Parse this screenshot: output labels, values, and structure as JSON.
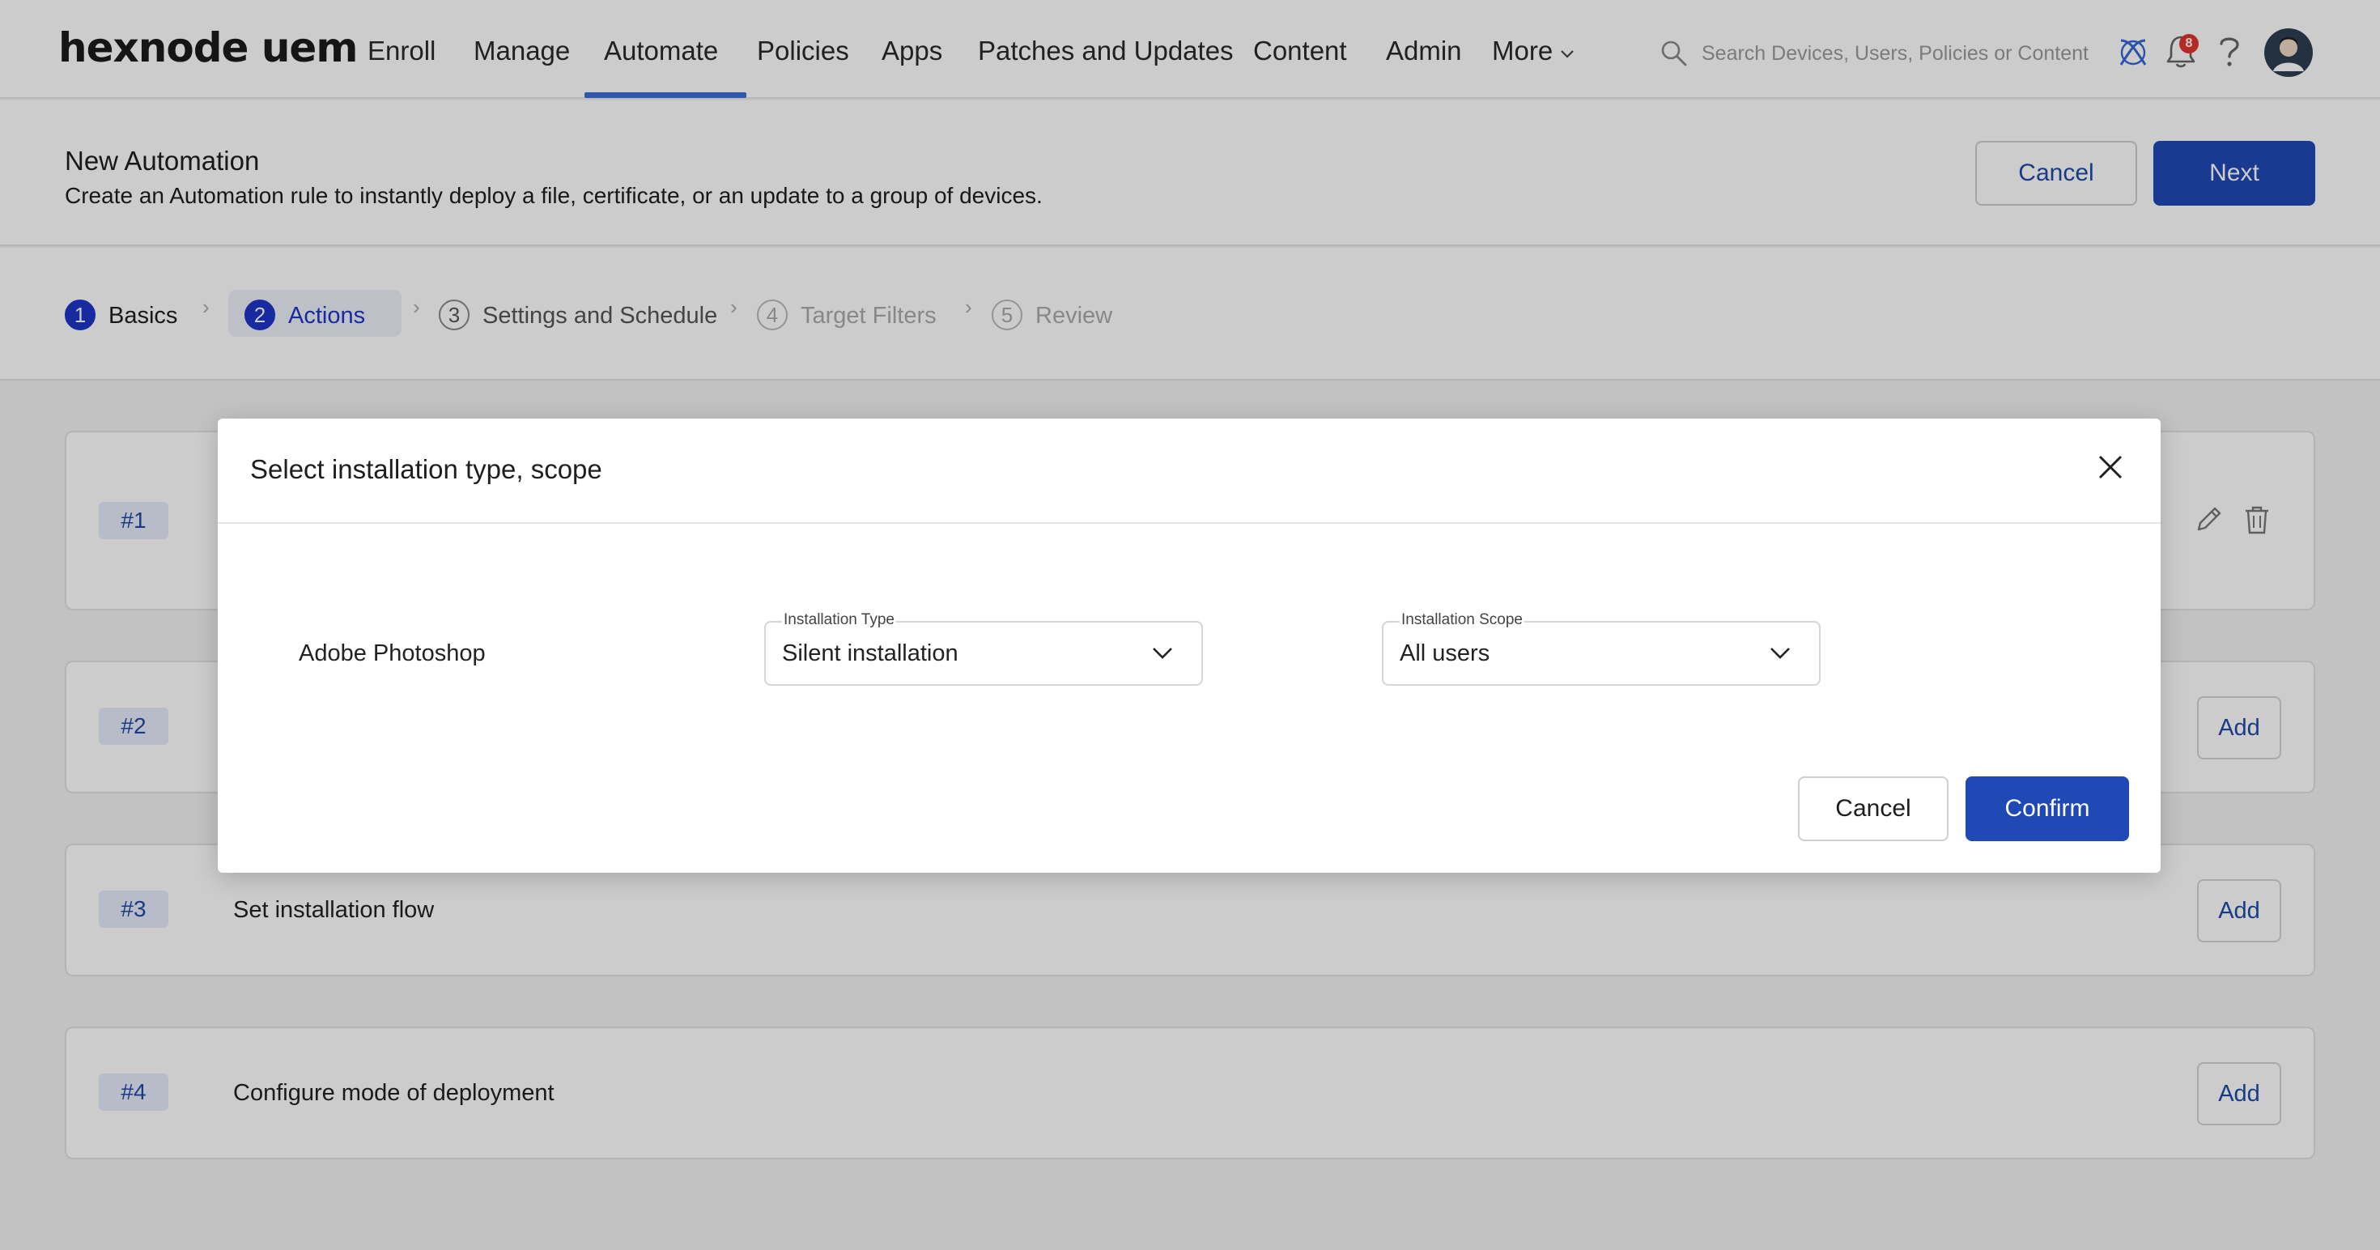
{
  "app": {
    "logo_text": "hexnode uem"
  },
  "nav": {
    "items": [
      {
        "label": "Enroll"
      },
      {
        "label": "Manage"
      },
      {
        "label": "Automate"
      },
      {
        "label": "Policies"
      },
      {
        "label": "Apps"
      },
      {
        "label": "Patches and Updates"
      },
      {
        "label": "Content"
      },
      {
        "label": "Admin"
      },
      {
        "label": "More"
      }
    ],
    "active_item": "Automate",
    "search_placeholder": "Search Devices, Users, Policies or Content",
    "notification_count": "8",
    "icons": [
      "search-icon",
      "integration-icon",
      "bell-icon",
      "help-icon",
      "avatar"
    ]
  },
  "header": {
    "title": "New Automation",
    "subtitle": "Create an Automation rule to instantly deploy a file, certificate, or an update to a group of devices.",
    "cancel_label": "Cancel",
    "next_label": "Next"
  },
  "stepper": {
    "steps": [
      {
        "num": "1",
        "label": "Basics",
        "state": "done"
      },
      {
        "num": "2",
        "label": "Actions",
        "state": "active"
      },
      {
        "num": "3",
        "label": "Settings and Schedule",
        "state": "pending"
      },
      {
        "num": "4",
        "label": "Target Filters",
        "state": "disabled"
      },
      {
        "num": "5",
        "label": "Review",
        "state": "disabled"
      }
    ]
  },
  "actions": [
    {
      "tag": "#1",
      "title": "",
      "controls": [
        "edit-icon",
        "delete-icon"
      ]
    },
    {
      "tag": "#2",
      "title": "",
      "add_label": "Add"
    },
    {
      "tag": "#3",
      "title": "Set installation flow",
      "add_label": "Add"
    },
    {
      "tag": "#4",
      "title": "Configure mode of deployment",
      "add_label": "Add"
    }
  ],
  "modal": {
    "title": "Select installation type, scope",
    "app_name": "Adobe Photoshop",
    "installation_type": {
      "label": "Installation Type",
      "value": "Silent installation"
    },
    "installation_scope": {
      "label": "Installation Scope",
      "value": "All users"
    },
    "cancel_label": "Cancel",
    "confirm_label": "Confirm"
  },
  "colors": {
    "primary": "#1f49b5",
    "accent_underline": "#3b6fd8",
    "step_active": "#1e35c8",
    "badge": "#e0352b"
  }
}
